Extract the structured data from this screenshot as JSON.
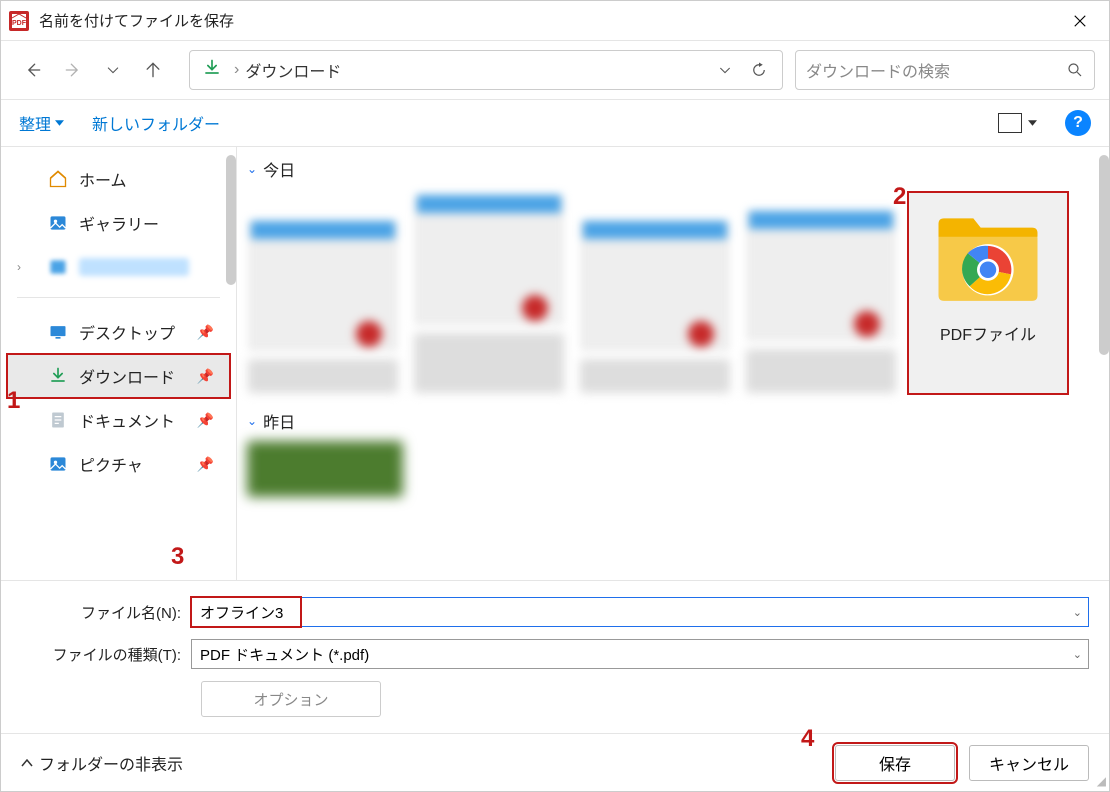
{
  "window": {
    "title": "名前を付けてファイルを保存"
  },
  "nav": {
    "crumb": "ダウンロード",
    "search_placeholder": "ダウンロードの検索"
  },
  "toolbar": {
    "organize": "整理",
    "new_folder": "新しいフォルダー"
  },
  "sidebar": {
    "home": "ホーム",
    "gallery": "ギャラリー",
    "desktop": "デスクトップ",
    "downloads": "ダウンロード",
    "documents": "ドキュメント",
    "pictures": "ピクチャ"
  },
  "groups": {
    "today": "今日",
    "yesterday": "昨日"
  },
  "folder_tile": {
    "label": "PDFファイル"
  },
  "form": {
    "filename_label": "ファイル名(N):",
    "filename_value": "オフライン3",
    "filetype_label": "ファイルの種類(T):",
    "filetype_value": "PDF ドキュメント (*.pdf)",
    "options": "オプション"
  },
  "footer": {
    "hide_folders": "フォルダーの非表示",
    "save": "保存",
    "cancel": "キャンセル"
  },
  "annotations": {
    "a1": "1",
    "a2": "2",
    "a3": "3",
    "a4": "4"
  }
}
